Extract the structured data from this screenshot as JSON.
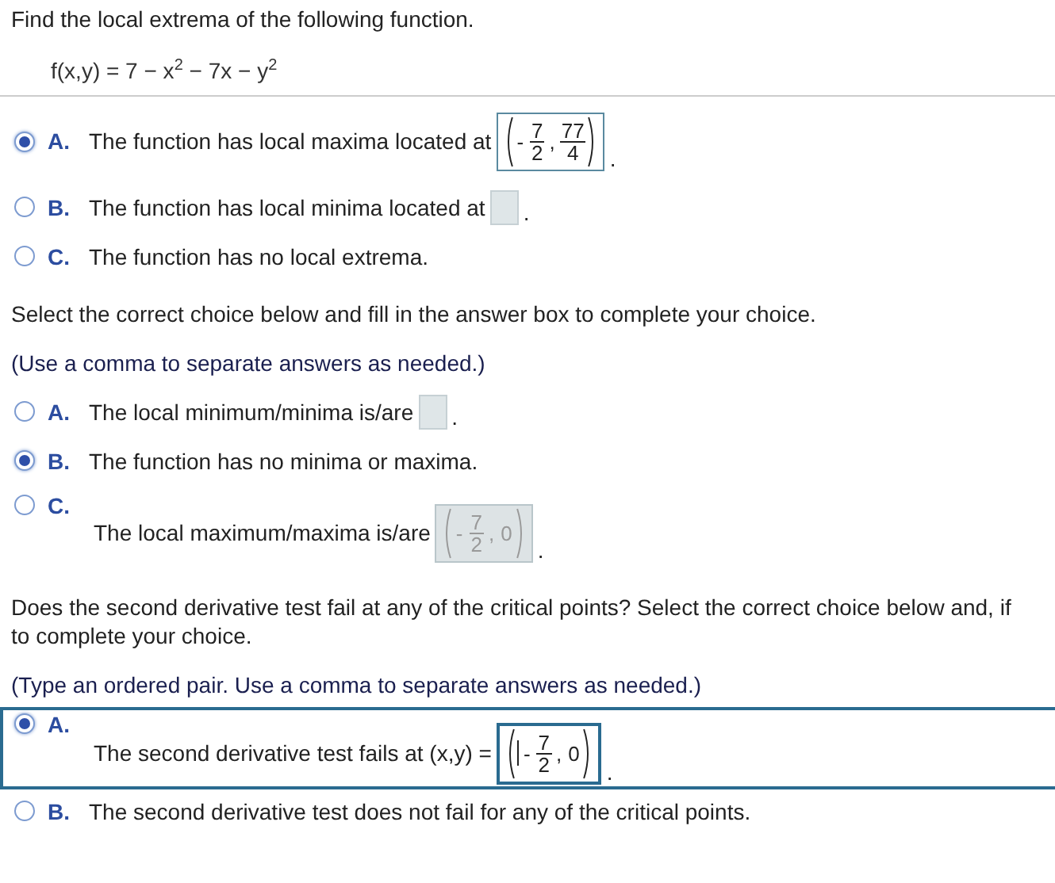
{
  "title": "Find the local extrema of the following function.",
  "function": "f(x,y) = 7 − x$^{2}$ − 7x − y$^{2}$",
  "questions": [
    {
      "choices": [
        {
          "letter": "A.",
          "kind": "inline",
          "text": "The function has local maxima located at",
          "selected": true,
          "focused": false,
          "answer": {
            "kind": "filled",
            "caret": false,
            "parts": [
              {
                "kind": "frac",
                "sign": "-",
                "num": "7",
                "den": "2"
              },
              {
                "kind": "text",
                "text": ","
              },
              {
                "kind": "frac",
                "num": "77",
                "den": "4"
              }
            ]
          },
          "suffix": "."
        },
        {
          "letter": "B.",
          "kind": "inline",
          "text": "The function has local minima located at",
          "selected": false,
          "focused": false,
          "answer": {
            "kind": "empty",
            "caret": false
          },
          "suffix": "."
        },
        {
          "letter": "C.",
          "kind": "inline",
          "text": "The function has no local extrema.",
          "selected": false,
          "focused": false
        }
      ]
    },
    {
      "prompt_lines": [
        "Select the correct choice below and fill in the answer box to complete your choice."
      ],
      "note": "(Use a comma to separate answers as needed.)",
      "choices": [
        {
          "letter": "A.",
          "kind": "inline",
          "text": "The local minimum/minima is/are",
          "selected": false,
          "focused": false,
          "answer": {
            "kind": "empty",
            "caret": false
          },
          "suffix": "."
        },
        {
          "letter": "B.",
          "kind": "inline",
          "text": "The function has no minima or maxima.",
          "selected": true,
          "focused": false
        },
        {
          "letter": "C.",
          "kind": "stacked",
          "text": "The local maximum/maxima is/are",
          "selected": false,
          "focused": false,
          "answer": {
            "kind": "disabled",
            "caret": false,
            "parts": [
              {
                "kind": "frac",
                "sign": "-",
                "num": "7",
                "den": "2"
              },
              {
                "kind": "text",
                "text": ","
              },
              {
                "kind": "text",
                "text": "0"
              }
            ]
          },
          "suffix": "."
        }
      ]
    },
    {
      "prompt_lines": [
        "Does the second derivative test fail at any of the critical points? Select the correct choice below and, if",
        "to complete your choice."
      ],
      "note": "(Type an ordered pair. Use a comma to separate answers as needed.)",
      "choices": [
        {
          "letter": "A.",
          "kind": "stacked",
          "text": "The second derivative test fails at (x,y) =",
          "selected": true,
          "focused": true,
          "answer": {
            "kind": "filled",
            "caret": true,
            "parts": [
              {
                "kind": "frac",
                "sign": "-",
                "num": "7",
                "den": "2"
              },
              {
                "kind": "text",
                "text": ","
              },
              {
                "kind": "text",
                "text": "0"
              }
            ]
          },
          "suffix": "."
        },
        {
          "letter": "B.",
          "kind": "inline",
          "text": "The second derivative test does not fail for any of the critical points.",
          "selected": false,
          "focused": false
        }
      ]
    }
  ]
}
